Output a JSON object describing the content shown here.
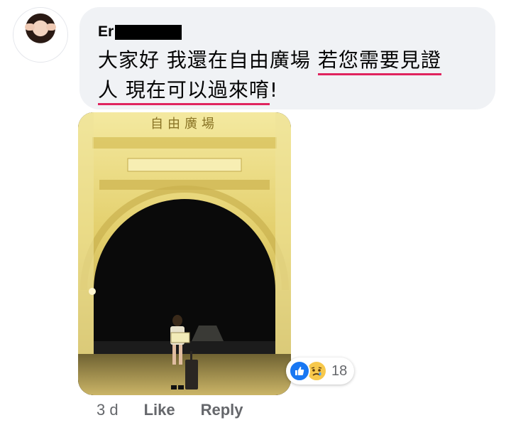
{
  "comment": {
    "author_visible": "Er",
    "message_plain": "大家好 我還在自由廣場 ",
    "message_underlined_1": "若您需要見證",
    "message_underlined_2": "人 現在可以過來唷",
    "message_tail": "!"
  },
  "photo": {
    "sign_text": "自由廣場"
  },
  "reactions": {
    "count": "18",
    "types": [
      "like-icon",
      "sad-icon"
    ],
    "like_color": "#1877f2",
    "sad_color": "#f7c84b"
  },
  "footer": {
    "timestamp": "3 d",
    "like_label": "Like",
    "reply_label": "Reply"
  },
  "colors": {
    "bubble": "#f0f2f5",
    "underline": "#e0245e",
    "meta_text": "#65676b"
  }
}
